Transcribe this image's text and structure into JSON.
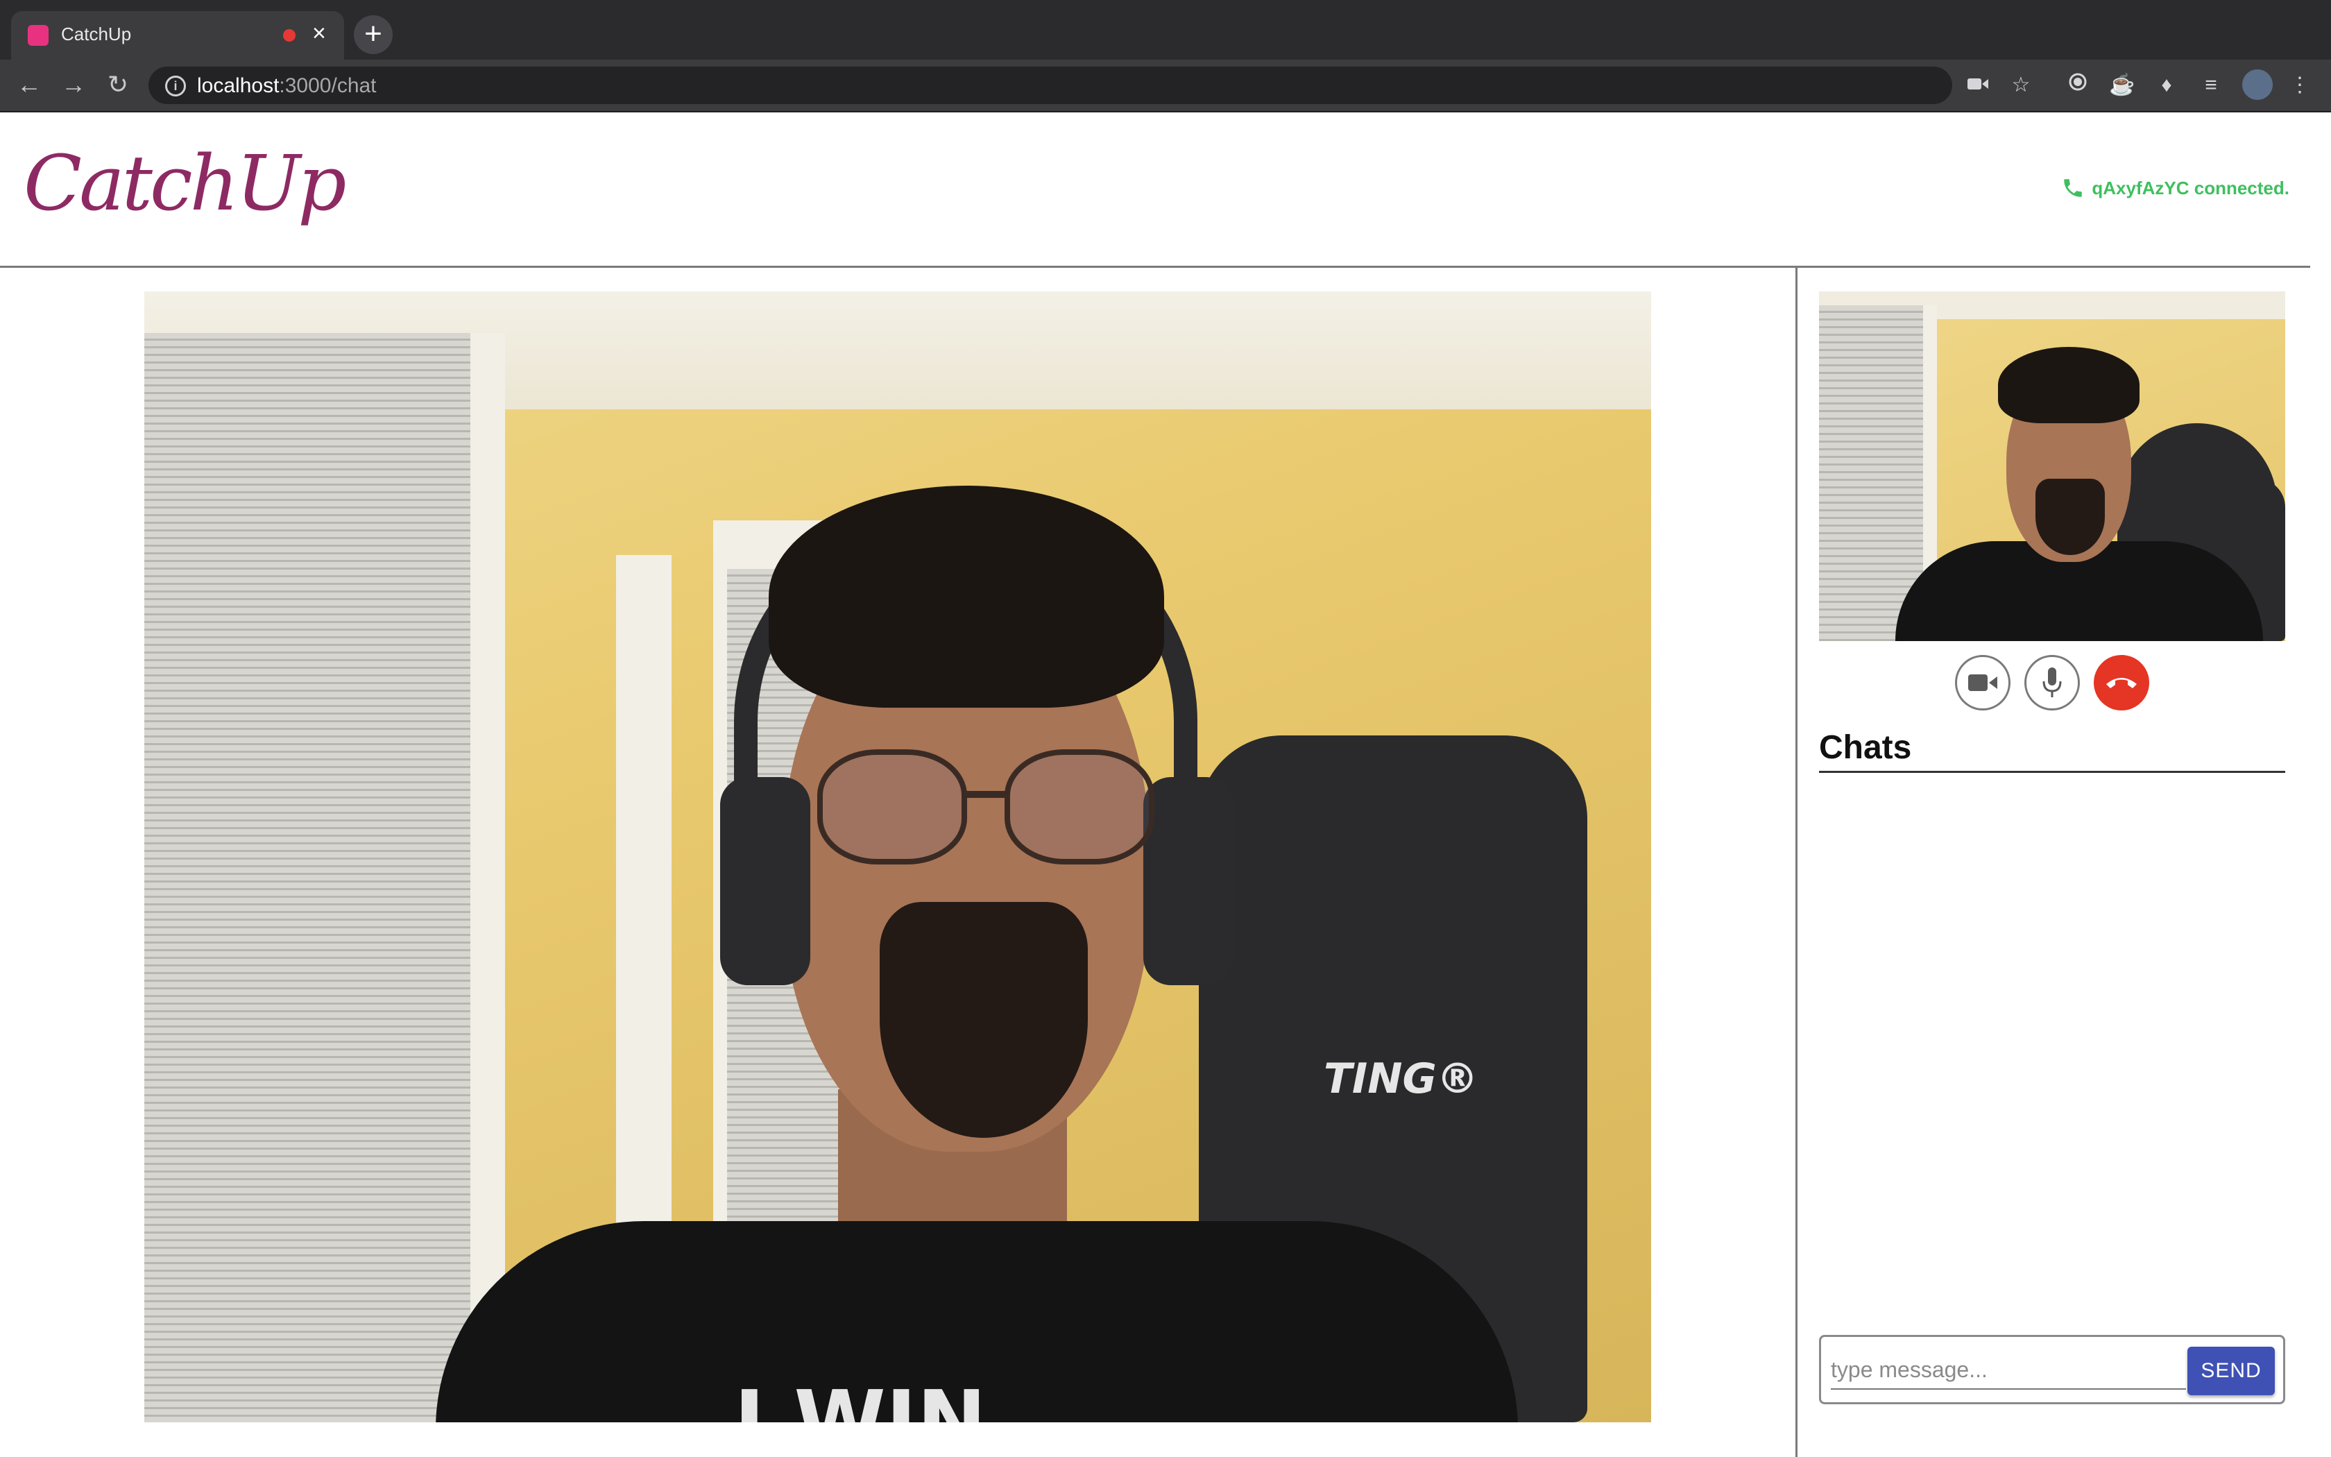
{
  "browser": {
    "tab_title": "CatchUp",
    "tab_close": "×",
    "new_tab": "+",
    "url_host": "localhost",
    "url_path": ":3000/chat"
  },
  "app": {
    "logo": "CatchUp",
    "status": "qAxyfAzYC connected."
  },
  "call_controls": [
    "video-camera-icon",
    "microphone-icon",
    "hangup-phone-icon"
  ],
  "chat": {
    "heading": "Chats",
    "placeholder": "type message...",
    "send_label": "SEND"
  },
  "video_shirt_text": "I WIN",
  "video_chair_text": "TING®",
  "colors": {
    "brand": "#8e2a63",
    "connected": "#3fbf5f",
    "hangup": "#e53524",
    "send_button": "#3f51b5"
  }
}
